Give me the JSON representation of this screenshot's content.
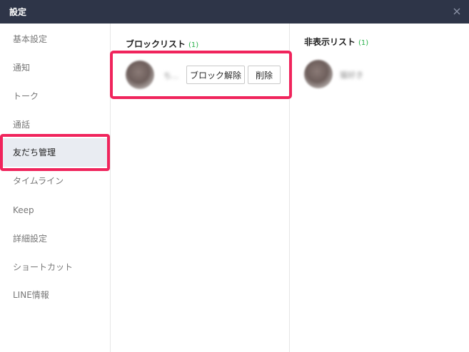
{
  "window": {
    "title": "設定",
    "close_icon": "close-icon"
  },
  "sidebar": {
    "items": [
      {
        "label": "基本設定"
      },
      {
        "label": "通知"
      },
      {
        "label": "トーク"
      },
      {
        "label": "通話"
      },
      {
        "label": "友だち管理",
        "active": true
      },
      {
        "label": "タイムライン"
      },
      {
        "label": "Keep"
      },
      {
        "label": "詳細設定"
      },
      {
        "label": "ショートカット"
      },
      {
        "label": "LINE情報"
      }
    ]
  },
  "block_list": {
    "title": "ブロックリスト",
    "count": "(1)",
    "entries": [
      {
        "name": "ち...",
        "unblock_label": "ブロック解除",
        "delete_label": "削除"
      }
    ]
  },
  "hidden_list": {
    "title": "非表示リスト",
    "count": "(1)",
    "entries": [
      {
        "name": "猫好き"
      }
    ]
  },
  "colors": {
    "titlebar": "#2e3548",
    "highlight": "#f0245c",
    "count": "#2bb24c",
    "active_item_bg": "#e9ecf2"
  }
}
